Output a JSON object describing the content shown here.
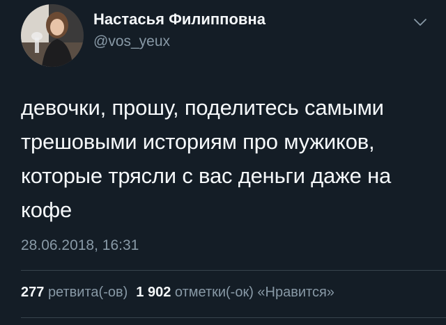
{
  "user": {
    "display_name": "Настасья Филипповна",
    "handle": "@vos_yeux",
    "avatar_icon": "profile-photo"
  },
  "tweet": {
    "text": "девочки, прошу, поделитесь самыми трешовыми историям про мужиков, которые трясли с вас деньги даже на кофе",
    "timestamp": "28.06.2018, 16:31"
  },
  "stats": {
    "retweets_count": "277",
    "retweets_label": "ретвита(-ов)",
    "likes_count": "1 902",
    "likes_label": "отметки(-ок) «Нравится»"
  },
  "colors": {
    "background": "#141d26",
    "text_primary": "#f5f8fa",
    "text_secondary": "#8899a6",
    "divider": "#38444d"
  },
  "icons": {
    "menu": "chevron-down-icon"
  }
}
